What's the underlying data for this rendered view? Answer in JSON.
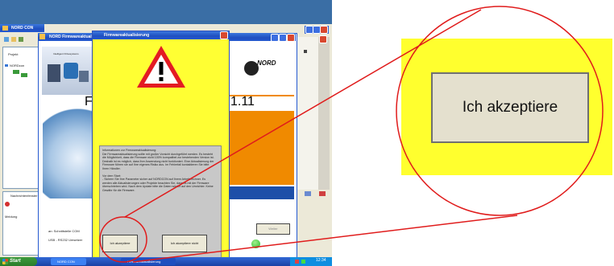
{
  "app_window": {
    "title": "NORD CON",
    "tree_items": [
      "Projekt",
      "NORDcon"
    ],
    "labels": [
      "Nachrichtenfenster",
      "Meldung"
    ]
  },
  "firmware_window": {
    "title": "NORD Firmwareaktualisierung",
    "banner_text": "Intelligent Drivesystems",
    "brand": "NORD",
    "heading_left": "Fir",
    "version": "1.11",
    "status_line_1": "an: Schnittstelle COM",
    "status_line_2": "USB - RS232 Umsetzer",
    "right_button": "Weiter"
  },
  "dialog": {
    "title": "Firmwareaktualisierung",
    "info_heading": "Informationen zur Firmwareaktualisierung:",
    "info_text": "Die Firmwareaktualisierung sollte mit großer Vorsicht durchgeführt werden. Es besteht die Möglichkeit, dass die Firmware nicht 100% kompatibel zur bestehenden Version ist. Deshalb ist es möglich, dass Ihre Anwendung nicht funktioniert. Eine Aktualisierung der Firmware führen sie auf Ihre eigenes Risiko aus. Im Fehlerfall kontaktieren Sie bitte Ihren Händler.",
    "info_heading_2": "Vor dem Start:",
    "info_text_2": "- Sichern Sie Ihre Parameter sicher auf NORDCON auf Ihrem Arbeitsrechner. Es werden alle Aktualisierungen oder Projekte beachten Sie, dass es mit der Firmware überschrieben wird. Nach dem Update bitte die Daten wieder auf den Umrichter. Keine Gewähr für die Firmware.",
    "accept_label": "Ich akzeptiere",
    "decline_label": "Ich akzeptiere nicht"
  },
  "taskbar": {
    "start_label": "Start",
    "items": [
      "NORD CON",
      "Firmwareaktualisierung"
    ],
    "clock": "12:34"
  },
  "zoom": {
    "button_label": "Ich akzeptiere"
  },
  "colors": {
    "highlight_yellow": "#ffff2e",
    "circle_red": "#e01b1b",
    "warning_red": "#e31b23",
    "nord_orange": "#f08a00",
    "xp_blue": "#2459d0"
  }
}
